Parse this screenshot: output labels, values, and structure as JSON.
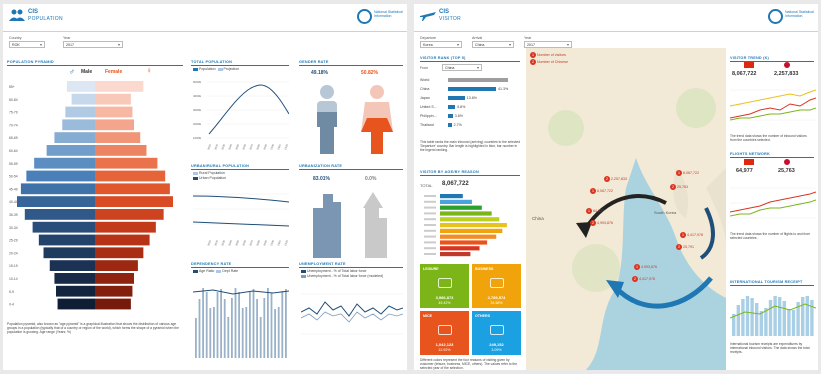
{
  "left": {
    "title": "CIS",
    "subtitle": "POPULATION",
    "logo_text": "National Statistical Information",
    "filters": [
      {
        "label": "Country",
        "value": "ROK"
      },
      {
        "label": "Year",
        "value": "2017"
      }
    ],
    "pyramid": {
      "title": "POPULATION PYRAMID",
      "male_label": "Male",
      "female_label": "Female",
      "male_symbol": "♂",
      "female_symbol": "♀",
      "age_groups": [
        "85+",
        "80-84",
        "75-79",
        "70-74",
        "65-69",
        "60-64",
        "55-59",
        "50-54",
        "45-49",
        "40-44",
        "35-39",
        "30-34",
        "25-29",
        "20-24",
        "15-19",
        "10-14",
        "5-9",
        "0-4"
      ],
      "male": [
        0.36,
        0.3,
        0.38,
        0.42,
        0.52,
        0.62,
        0.78,
        0.88,
        0.95,
        1.0,
        0.9,
        0.8,
        0.72,
        0.66,
        0.58,
        0.52,
        0.5,
        0.48
      ],
      "female": [
        0.62,
        0.46,
        0.48,
        0.5,
        0.58,
        0.66,
        0.8,
        0.9,
        0.96,
        1.0,
        0.88,
        0.78,
        0.7,
        0.62,
        0.55,
        0.5,
        0.48,
        0.46
      ],
      "footnote": "Population pyramid, also known as \"age pyramid\" is a graphical illustration that shows the distribution of various age groups in a population (typically that of a country or region of the world), which forms the shape of a pyramid when the population is growing. Age range (Years: %)"
    },
    "total_pop": {
      "title": "TOTAL POPULATION",
      "legend": [
        "Population",
        "Projection"
      ],
      "y_ticks": [
        "5000k",
        "4000k",
        "3000k",
        "2000k",
        "1000k"
      ],
      "x_ticks": [
        "2010",
        "2020",
        "2030",
        "2040",
        "2050",
        "2060",
        "2070",
        "2080",
        "2090",
        "2100",
        "2110",
        "2120"
      ]
    },
    "gender": {
      "title": "GENDER RATE",
      "male_pct": "49.18%",
      "female_pct": "50.82%"
    },
    "urban": {
      "title": "URBAN/RURAL POPULATION",
      "legend": [
        "Rural Population",
        "Urban Population"
      ]
    },
    "urbanization": {
      "title": "URBANIZATION RATE",
      "urban_pct": "83.01%",
      "rural_pct": "0.0%"
    },
    "dependency": {
      "title": "DEPENDENCY RATE",
      "legend": [
        "Age Ratio",
        "Dept Rate"
      ]
    },
    "unemployment": {
      "title": "UNEMPLOYMENT RATE",
      "legend": [
        "Unemployment - % of Total labor force",
        "Unemployment - % of Total labor force (modeled)"
      ]
    }
  },
  "right": {
    "title": "CIS",
    "subtitle": "VISITOR",
    "logo_text": "National Statistical Information",
    "filters": [
      {
        "label": "Departure",
        "value": "Korea"
      },
      {
        "label": "Arrival",
        "value": "China"
      },
      {
        "label": "Year",
        "value": "2017"
      }
    ],
    "visitor_rank": {
      "title": "VISITOR RANK (TOP 5)",
      "from_label": "From",
      "from_value": "China",
      "rows": [
        {
          "label": "World",
          "value": "",
          "pct": 1.0
        },
        {
          "label": "China",
          "value": "41.3%",
          "pct": 0.8
        },
        {
          "label": "Japan",
          "value": "13.8%",
          "pct": 0.28
        },
        {
          "label": "United S...",
          "value": "5.8%",
          "pct": 0.12
        },
        {
          "label": "Philippin...",
          "value": "3.6%",
          "pct": 0.08
        },
        {
          "label": "Thailand",
          "value": "2.7%",
          "pct": 0.06
        }
      ],
      "note": "This table ranks the main inbound (arriving) countries to the selected 'Departure' country. Bar length is highlighted in blue, bar number in the legend ranking."
    },
    "visitor_age": {
      "title": "VISITOR BY AGE/BY REASON",
      "total_label": "TOTAL",
      "total_value": "8,067,722"
    },
    "tiles": [
      {
        "name": "leisure",
        "title": "LEISURE",
        "value": "3,986,873",
        "pct": "49.42%",
        "color": "#7cb518"
      },
      {
        "name": "business",
        "title": "BUSINESS",
        "value": "2,789,574",
        "pct": "34.58%",
        "color": "#f0a30a"
      },
      {
        "name": "mice",
        "title": "MICE",
        "value": "1,042,123",
        "pct": "12.92%",
        "color": "#e8541d"
      },
      {
        "name": "others",
        "title": "OTHERS",
        "value": "249,152",
        "pct": "3.09%",
        "color": "#1ba1e2"
      }
    ],
    "tiles_note": "Different colors represent the four reasons of visiting given by customer (leisure, business, MICE, others). The values refer to the selected year of the selection.",
    "map": {
      "legend": [
        "Number of visitors",
        "Number of Chinese"
      ],
      "country_china": "China",
      "country_korea": "South Korea",
      "pins": [
        "8,067,722",
        "2,257,833",
        "64,977",
        "4,993,876",
        "8,067,722",
        "25,763",
        "4,417,978",
        "25,791",
        "4,993,876",
        "4,417,978"
      ]
    },
    "trend": {
      "title": "VISITOR TREND (K)",
      "left_value": "8,067,722",
      "right_value": "2,257,833",
      "note": "The trend data shows the number of inbound visitors from the countries selected."
    },
    "flights": {
      "title": "FLIGHTS NETWORK",
      "left_value": "64,977",
      "right_value": "25,763",
      "note": "The trend data shows the number of flights to and from selected countries."
    },
    "intl": {
      "title": "INTERNATIONAL TOURISM RECEIPT",
      "note": "International tourism receipts are expenditures by international inbound visitors. The data shows the total receipts."
    }
  }
}
